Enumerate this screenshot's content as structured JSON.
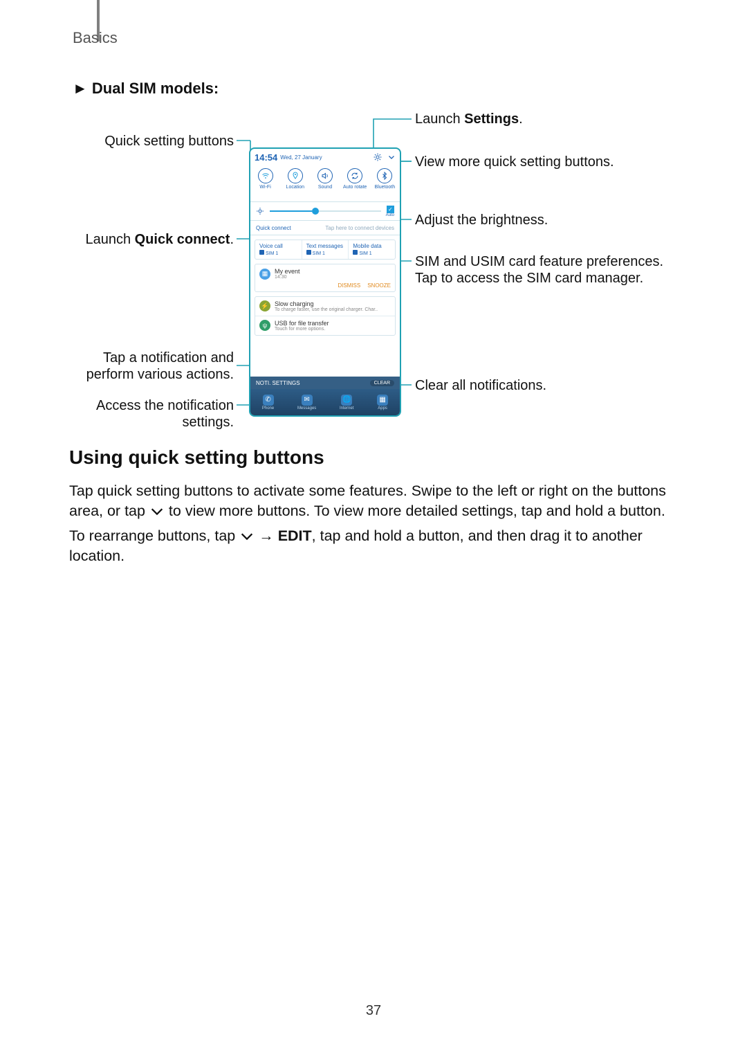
{
  "header": {
    "section": "Basics"
  },
  "page_number": "37",
  "section": {
    "bullet": "► Dual SIM models:",
    "heading": "Using quick setting buttons",
    "para1_a": "Tap quick setting buttons to activate some features. Swipe to the left or right on the buttons area, or tap ",
    "para1_b": " to view more buttons. To view more detailed settings, tap and hold a button.",
    "para2_a": "To rearrange buttons, tap ",
    "para2_b": " → ",
    "para2_edit": "EDIT",
    "para2_c": ", tap and hold a button, and then drag it to another location."
  },
  "callouts": {
    "left": {
      "quick_setting_buttons": "Quick setting buttons",
      "quick_connect_a": "Launch ",
      "quick_connect_b": "Quick connect",
      "quick_connect_c": ".",
      "notif_tap": "Tap a notification and perform various actions.",
      "notif_settings": "Access the notification settings."
    },
    "right": {
      "settings_a": "Launch ",
      "settings_b": "Settings",
      "settings_c": ".",
      "view_more": "View more quick setting buttons.",
      "brightness": "Adjust the brightness.",
      "sim": "SIM and USIM card feature preferences. Tap to access the SIM card manager.",
      "clear": "Clear all notifications."
    }
  },
  "phone": {
    "time": "14:54",
    "date": "Wed, 27 January",
    "qs": [
      {
        "label": "Wi-Fi",
        "glyph": "wifi"
      },
      {
        "label": "Location",
        "glyph": "pin"
      },
      {
        "label": "Sound",
        "glyph": "sound"
      },
      {
        "label": "Auto rotate",
        "glyph": "rotate"
      },
      {
        "label": "Bluetooth",
        "glyph": "bt"
      }
    ],
    "auto": "Auto",
    "quick_connect": "Quick connect",
    "quick_connect_hint": "Tap here to connect devices",
    "sim_cols": [
      {
        "title": "Voice call",
        "sub": "SIM 1"
      },
      {
        "title": "Text messages",
        "sub": "SIM 1"
      },
      {
        "title": "Mobile data",
        "sub": "SIM 1"
      }
    ],
    "event": {
      "title": "My event",
      "time": "14:30",
      "dismiss": "DISMISS",
      "snooze": "SNOOZE"
    },
    "notifs": [
      {
        "title": "Slow charging",
        "sub": "To charge faster, use the original charger. Char..",
        "color": "#8aa534"
      },
      {
        "title": "USB for file transfer",
        "sub": "Touch for more options.",
        "color": "#2f9e69"
      }
    ],
    "noti_settings": "NOTI. SETTINGS",
    "clear": "CLEAR",
    "dock": [
      "Phone",
      "Messages",
      "Internet",
      "Apps"
    ]
  }
}
